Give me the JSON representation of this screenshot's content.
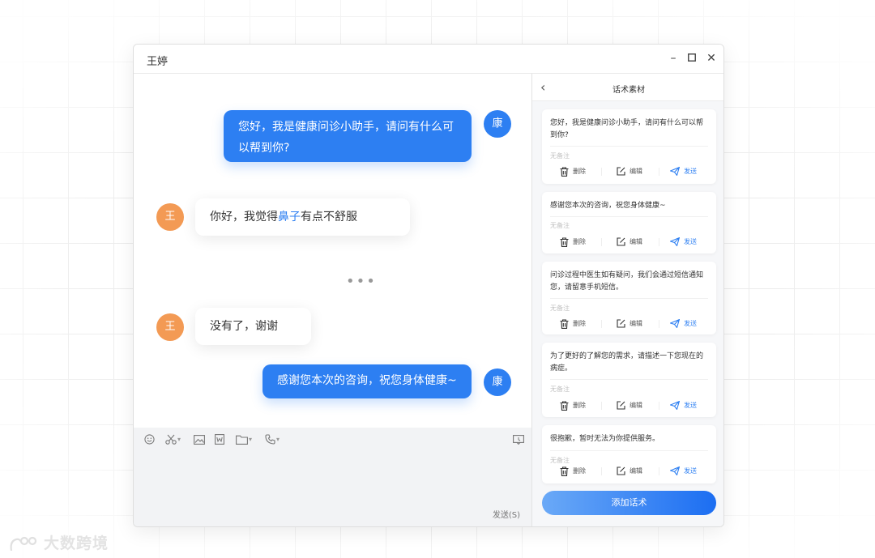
{
  "window": {
    "title": "王婷",
    "minimize": "–",
    "maximize": "☐",
    "close": "✕"
  },
  "messages": [
    {
      "side": "out",
      "avatar": "康",
      "text": "您好，我是健康问诊小助手，请问有什么可以帮到你?"
    },
    {
      "side": "in",
      "avatar": "王",
      "text_before": "你好，我觉得",
      "text_highlight": "鼻子",
      "text_after": "有点不舒服"
    },
    {
      "side": "in",
      "avatar": "王",
      "text": "没有了，谢谢"
    },
    {
      "side": "out",
      "avatar": "康",
      "text": "感谢您本次的咨询，祝您身体健康~"
    }
  ],
  "ellipsis": "•••",
  "composer": {
    "send_label": "发送(S)"
  },
  "panel": {
    "back": "‹",
    "title": "话术素材",
    "note_placeholder": "无备注",
    "actions": {
      "delete": "删除",
      "edit": "编辑",
      "send": "发送"
    },
    "cards": [
      {
        "text": "您好，我是健康问诊小助手，请问有什么可以帮到你?"
      },
      {
        "text": "感谢您本次的咨询，祝您身体健康~"
      },
      {
        "text": "问诊过程中医生如有疑问，我们会通过短信通知您，请留意手机短信。"
      },
      {
        "text": "为了更好的了解您的需求，请描述一下您现在的病症。"
      },
      {
        "text": "很抱歉，暂时无法为你提供服务。"
      }
    ],
    "add_button": "添加话术"
  },
  "watermark": "大数跨境",
  "colors": {
    "accent": "#2d7ff2",
    "avatar_user": "#f39a54",
    "panel_bg": "#f6f7f9"
  }
}
